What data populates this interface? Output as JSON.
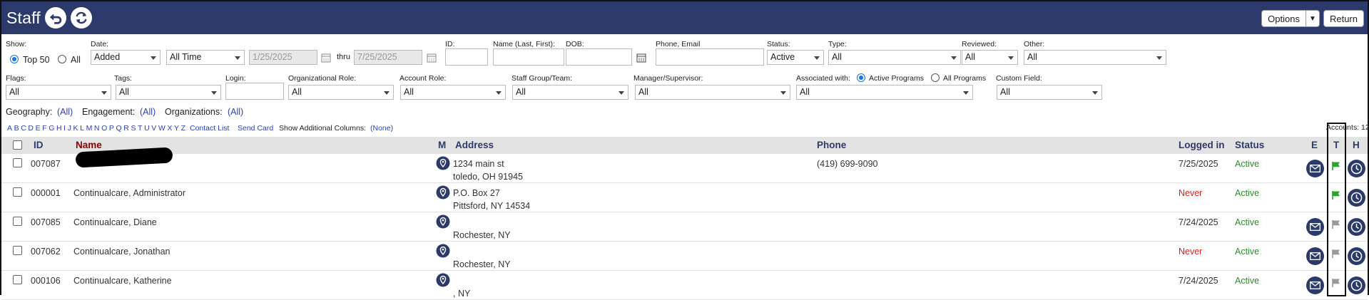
{
  "header": {
    "title": "Staff",
    "options_label": "Options",
    "return_label": "Return"
  },
  "filters": {
    "show_label": "Show:",
    "top50_label": "Top 50",
    "all_label": "All",
    "date_label": "Date:",
    "date_type": "Added",
    "date_range": "All Time",
    "date_from": "1/25/2025",
    "thru_label": "thru",
    "date_to": "7/25/2025",
    "id_label": "ID:",
    "name_label": "Name (Last, First):",
    "dob_label": "DOB:",
    "phone_label": "Phone, Email",
    "status_label": "Status:",
    "status_value": "Active",
    "type_label": "Type:",
    "type_value": "All",
    "reviewed_label": "Reviewed:",
    "reviewed_value": "All",
    "other_label": "Other:",
    "other_value": "All",
    "flags_label": "Flags:",
    "flags_value": "All",
    "tags_label": "Tags:",
    "tags_value": "All",
    "login_label": "Login:",
    "org_role_label": "Organizational Role:",
    "org_role_value": "All",
    "account_role_label": "Account Role:",
    "account_role_value": "All",
    "staff_group_label": "Staff Group/Team:",
    "staff_group_value": "All",
    "manager_label": "Manager/Supervisor:",
    "manager_value": "All",
    "assoc_label": "Associated with:",
    "active_programs_label": "Active Programs",
    "all_programs_label": "All Programs",
    "assoc_value": "All",
    "custom_field_label": "Custom Field:",
    "custom_field_value": "All"
  },
  "geo": {
    "geography_label": "Geography:",
    "geography_value": "(All)",
    "engagement_label": "Engagement:",
    "engagement_value": "(All)",
    "organizations_label": "Organizations:",
    "organizations_value": "(All)"
  },
  "alpha_links": [
    "A",
    "B",
    "C",
    "D",
    "E",
    "F",
    "G",
    "H",
    "I",
    "J",
    "K",
    "L",
    "M",
    "N",
    "O",
    "P",
    "Q",
    "R",
    "S",
    "T",
    "U",
    "V",
    "W",
    "X",
    "Y",
    "Z"
  ],
  "toolbar": {
    "contact_list": "Contact List",
    "send_card": "Send Card",
    "additional_cols_label": "Show Additional Columns:",
    "additional_cols_value": "(None)",
    "accounts": "Accounts: 12"
  },
  "columns": {
    "id": "ID",
    "name": "Name",
    "m": "M",
    "address": "Address",
    "phone": "Phone",
    "logged_in": "Logged in",
    "status": "Status",
    "e": "E",
    "t": "T",
    "h": "H"
  },
  "rows": [
    {
      "id": "007087",
      "name": "",
      "addr1": "1234 main st",
      "addr2": "toledo, OH 91945",
      "phone": "(419) 699-9090",
      "logged": "7/25/2025",
      "status": "Active",
      "email": true,
      "flag": "green"
    },
    {
      "id": "000001",
      "name": "Continualcare, Administrator",
      "addr1": "P.O. Box 27",
      "addr2": "Pittsford, NY 14534",
      "phone": "",
      "logged": "Never",
      "status": "Active",
      "email": false,
      "flag": "green"
    },
    {
      "id": "007085",
      "name": "Continualcare, Diane",
      "addr1": "",
      "addr2": "Rochester, NY",
      "phone": "",
      "logged": "7/24/2025",
      "status": "Active",
      "email": true,
      "flag": "gray"
    },
    {
      "id": "007062",
      "name": "Continualcare, Jonathan",
      "addr1": "",
      "addr2": "Rochester, NY",
      "phone": "",
      "logged": "Never",
      "status": "Active",
      "email": true,
      "flag": "gray"
    },
    {
      "id": "000106",
      "name": "Continualcare, Katherine",
      "addr1": "",
      "addr2": ", NY",
      "phone": "",
      "logged": "7/24/2025",
      "status": "Active",
      "email": true,
      "flag": "gray"
    }
  ],
  "colors": {
    "header_bg": "#2b3a6b",
    "link": "#2b3fb5",
    "never": "#e02020",
    "active": "#2e8b2e",
    "flag_green": "#2aa52a",
    "flag_gray": "#9a9a9a"
  }
}
